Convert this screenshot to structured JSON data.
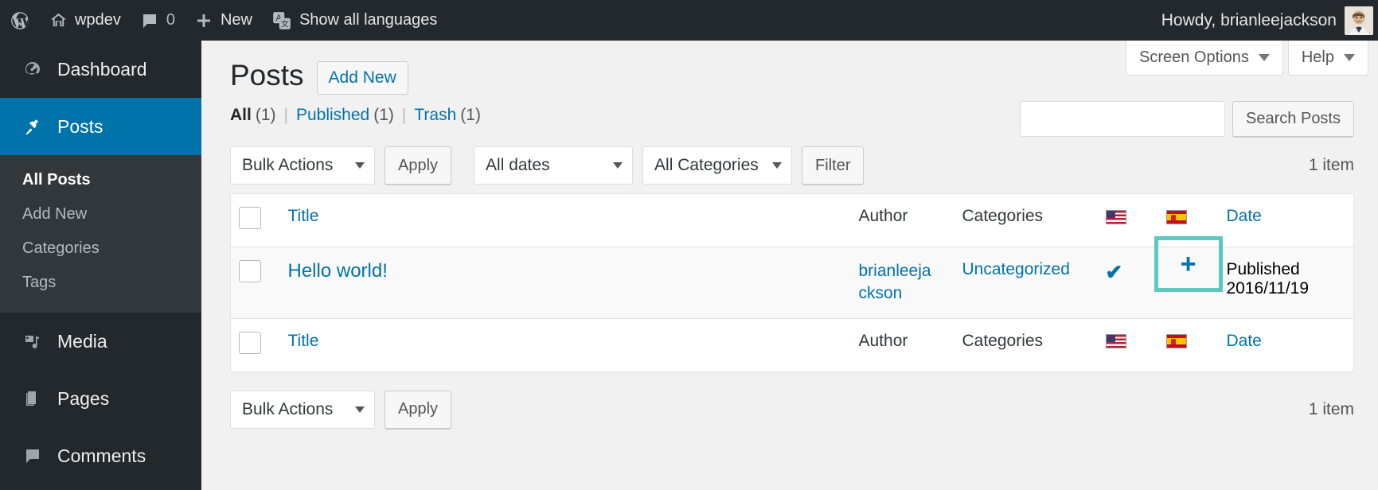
{
  "adminbar": {
    "wp_logo_title": "About WordPress",
    "site_name": "wpdev",
    "comments_count": "0",
    "new_label": "New",
    "languages_label": "Show all languages",
    "howdy": "Howdy, brianleejackson"
  },
  "sidebar": {
    "items": [
      {
        "label": "Dashboard",
        "icon": "dashboard-icon",
        "current": false
      },
      {
        "label": "Posts",
        "icon": "pin-icon",
        "current": true
      },
      {
        "label": "Media",
        "icon": "media-icon",
        "current": false
      },
      {
        "label": "Pages",
        "icon": "pages-icon",
        "current": false
      },
      {
        "label": "Comments",
        "icon": "comments-icon",
        "current": false
      }
    ],
    "submenu": [
      {
        "label": "All Posts",
        "current": true
      },
      {
        "label": "Add New",
        "current": false
      },
      {
        "label": "Categories",
        "current": false
      },
      {
        "label": "Tags",
        "current": false
      }
    ]
  },
  "screen_meta": {
    "screen_options": "Screen Options",
    "help": "Help"
  },
  "page": {
    "title": "Posts",
    "add_new": "Add New"
  },
  "status_links": {
    "all_label": "All",
    "all_count": "(1)",
    "published_label": "Published",
    "published_count": "(1)",
    "trash_label": "Trash",
    "trash_count": "(1)",
    "separator": "|"
  },
  "search": {
    "value": "",
    "placeholder": "",
    "button": "Search Posts"
  },
  "tablenav_top": {
    "bulk_actions": "Bulk Actions",
    "apply": "Apply",
    "all_dates": "All dates",
    "all_categories": "All Categories",
    "filter": "Filter",
    "displaying_num": "1 item"
  },
  "tablenav_bottom": {
    "bulk_actions": "Bulk Actions",
    "apply": "Apply",
    "displaying_num": "1 item"
  },
  "table": {
    "columns": {
      "title": "Title",
      "author": "Author",
      "categories": "Categories",
      "flag_en": "flag-us-icon",
      "flag_es": "flag-es-icon",
      "date": "Date"
    },
    "rows": [
      {
        "title": "Hello world!",
        "author": "brianleejackson",
        "categories": "Uncategorized",
        "translation_en": "✔",
        "translation_es": "+",
        "date_status": "Published",
        "date_value": "2016/11/19"
      }
    ]
  },
  "highlight": {
    "target": "add-spanish-translation-button",
    "color": "#5cc8c0"
  },
  "colors": {
    "admin_bar_bg": "#23282d",
    "menu_current_bg": "#0073aa",
    "link": "#0073aa",
    "body_bg": "#f1f1f1",
    "highlight": "#5cc8c0"
  }
}
